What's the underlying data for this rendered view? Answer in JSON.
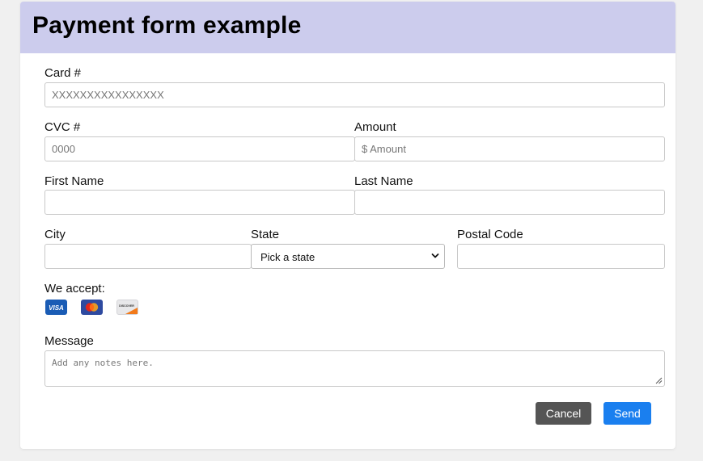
{
  "header": {
    "title": "Payment form example"
  },
  "form": {
    "card": {
      "label": "Card #",
      "placeholder": "XXXXXXXXXXXXXXXX"
    },
    "cvc": {
      "label": "CVC #",
      "placeholder": "0000"
    },
    "amount": {
      "label": "Amount",
      "placeholder": "$ Amount"
    },
    "first_name": {
      "label": "First Name",
      "placeholder": ""
    },
    "last_name": {
      "label": "Last Name",
      "placeholder": ""
    },
    "city": {
      "label": "City",
      "placeholder": ""
    },
    "state": {
      "label": "State",
      "selected": "Pick a state"
    },
    "postal": {
      "label": "Postal Code",
      "placeholder": ""
    },
    "accept": {
      "label": "We accept:",
      "cards": [
        {
          "name": "visa",
          "text": "VISA",
          "color": "#1a5cb5"
        },
        {
          "name": "mastercard",
          "text": "",
          "color": "#2e4aa0"
        },
        {
          "name": "discover",
          "text": "DISCOVER",
          "color": "#f27a1a"
        }
      ]
    },
    "message": {
      "label": "Message",
      "placeholder": "Add any notes here."
    }
  },
  "actions": {
    "cancel": "Cancel",
    "send": "Send"
  },
  "colors": {
    "header_bg": "#cccced",
    "cancel_bg": "#555555",
    "send_bg": "#1a7fef"
  }
}
